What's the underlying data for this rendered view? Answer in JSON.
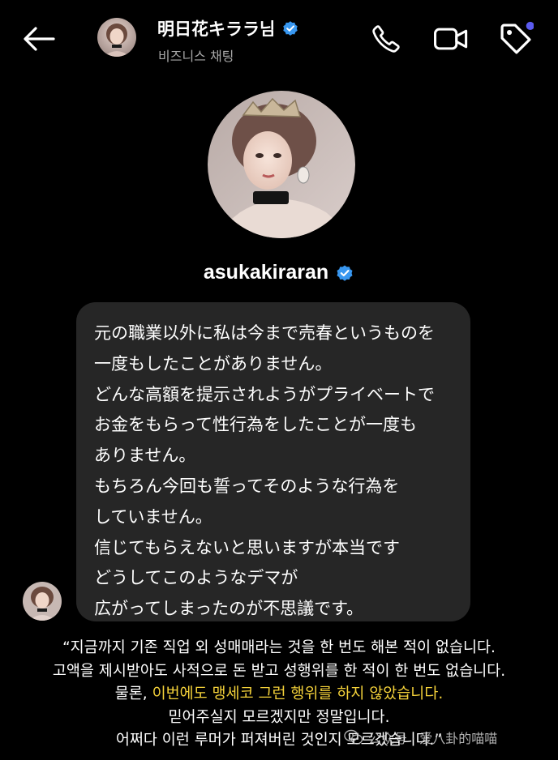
{
  "header": {
    "title": "明日花キララ님",
    "subtitle": "비즈니스 채팅",
    "back_icon": "arrow-left-icon",
    "call_icon": "phone-icon",
    "video_icon": "video-camera-icon",
    "tag_icon": "tag-icon",
    "notification_dot_color": "#5b5bf0"
  },
  "profile": {
    "username": "asukakiraran",
    "verified_color": "#3897f0"
  },
  "message": {
    "lines": [
      "元の職業以外に私は今まで売春というものを",
      "一度もしたことがありません。",
      "どんな高額を提示されようがプライベートで",
      "お金をもらって性行為をしたことが一度も",
      "ありません。",
      "もちろん今回も誓ってそのような行為を",
      "していません。",
      "信じてもらえないと思いますが本当です",
      "どうしてこのようなデマが",
      "広がってしまったのが不思議です。"
    ]
  },
  "caption": {
    "line1": "“지금까지 기존 직업 외 성매매라는 것을 한 번도 해본 적이 없습니다.",
    "line2": "고액을 제시받아도 사적으로 돈 받고 성행위를 한 적이 한 번도 없습니다.",
    "line3_prefix": "물론, ",
    "line3_highlight": "이번에도 맹세코 그런 행위를 하지 않았습니다.",
    "line4": "믿어주실지 모르겠지만 정말입니다.",
    "line5": "어쩌다 이런 루머가 퍼져버린 것인지 모르겠습니다.”",
    "highlight_color": "#f5d23a"
  },
  "watermark": {
    "text": "公众号 · 爱八卦的喵喵"
  }
}
